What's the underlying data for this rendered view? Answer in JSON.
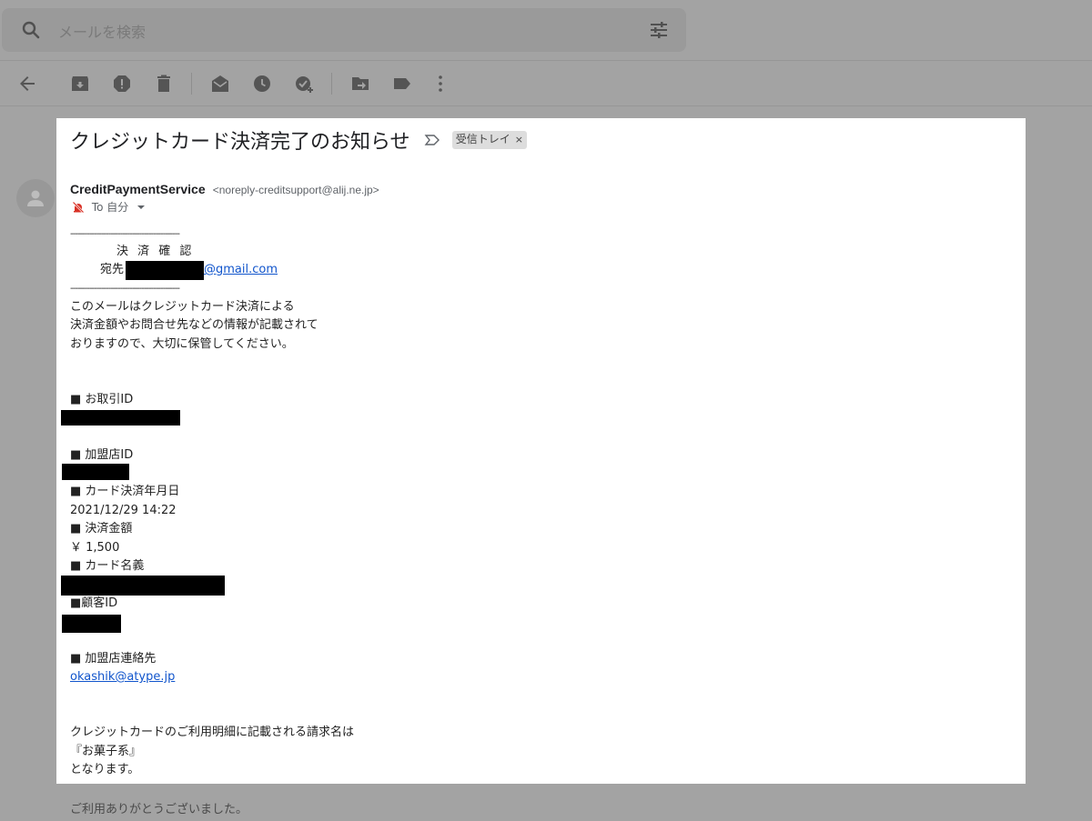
{
  "search": {
    "placeholder": "メールを検索"
  },
  "email": {
    "subject": "クレジットカード決済完了のお知らせ",
    "label": "受信トレイ",
    "label_close": "×",
    "sender_name": "CreditPaymentService",
    "sender_email": "<noreply-creditsupport@alij.ne.jp>",
    "to_text": "To 自分",
    "body": {
      "dash_line": "----------------------------------------------",
      "heading": "決 済 確 認",
      "recipient_label": "宛先",
      "recipient_domain": "@gmail.com",
      "intro": [
        "このメールはクレジットカード決済による",
        "決済金額やお問合せ先などの情報が記載されて",
        "おりますので、大切に保管してください。"
      ],
      "transaction_id_label": "■ お取引ID",
      "merchant_id_label": "■ 加盟店ID",
      "card_date_label": "■ カード決済年月日",
      "card_date_value": "2021/12/29 14:22",
      "amount_label": "■ 決済金額",
      "amount_value": "￥ 1,500",
      "card_holder_label": "■ カード名義",
      "customer_id_label": "■顧客ID",
      "merchant_contact_label": "■ 加盟店連絡先",
      "merchant_contact_value": "okashik@atype.jp",
      "billing_lines": [
        "クレジットカードのご利用明細に記載される請求名は",
        "『お菓子系』",
        "となります。"
      ],
      "closing": "ご利用ありがとうございました。"
    }
  },
  "colors": {
    "link": "#1155cc",
    "overlay": "#a3a3a3",
    "redaction": "#000000"
  }
}
